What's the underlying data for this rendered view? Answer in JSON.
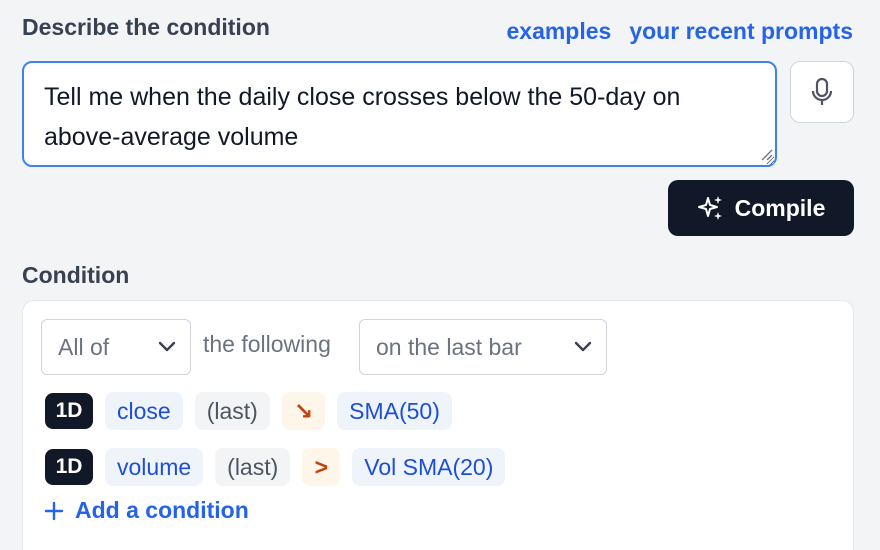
{
  "header": {
    "describe_label": "Describe the condition",
    "examples_link": "examples",
    "recent_link": "your recent prompts"
  },
  "prompt": {
    "value": "Tell me when the daily close crosses below the 50-day on above-average volume"
  },
  "compile_button": {
    "label": "Compile"
  },
  "condition": {
    "label": "Condition",
    "quantifier": "All of",
    "connector": "the following",
    "window": "on the last bar",
    "rows": [
      {
        "timeframe": "1D",
        "field": "close",
        "modifier": "(last)",
        "operator": "↘",
        "target": "SMA(50)"
      },
      {
        "timeframe": "1D",
        "field": "volume",
        "modifier": "(last)",
        "operator": ">",
        "target": "Vol SMA(20)"
      }
    ],
    "add_label": "Add a condition"
  },
  "icons": [
    "microphone-icon",
    "sparkles-icon",
    "chevron-down-icon",
    "plus-icon",
    "resize-grip-icon"
  ],
  "colors": {
    "accent": "#2563eb",
    "focus_border": "#3b82f6",
    "dark_button": "#111827",
    "operator": "#c2410c"
  }
}
